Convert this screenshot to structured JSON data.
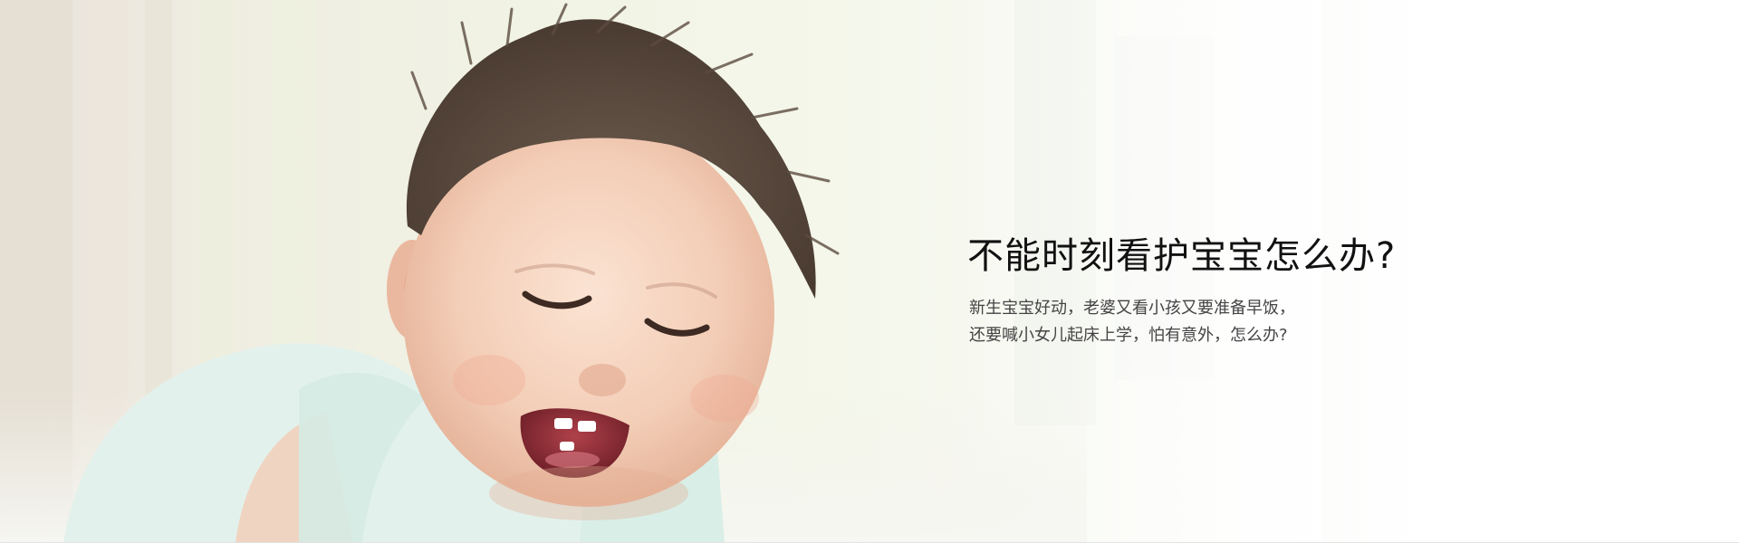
{
  "banner": {
    "headline": "不能时刻看护宝宝怎么办?",
    "description_lines": [
      "新生宝宝好动，老婆又看小孩又要准备早饭，",
      "还要喊小女儿起床上学，怕有意外，怎么办?"
    ],
    "image_subject": "smiling-baby-photo"
  },
  "colors": {
    "headline": "#111111",
    "description": "#444444",
    "background_right": "#ffffff"
  }
}
